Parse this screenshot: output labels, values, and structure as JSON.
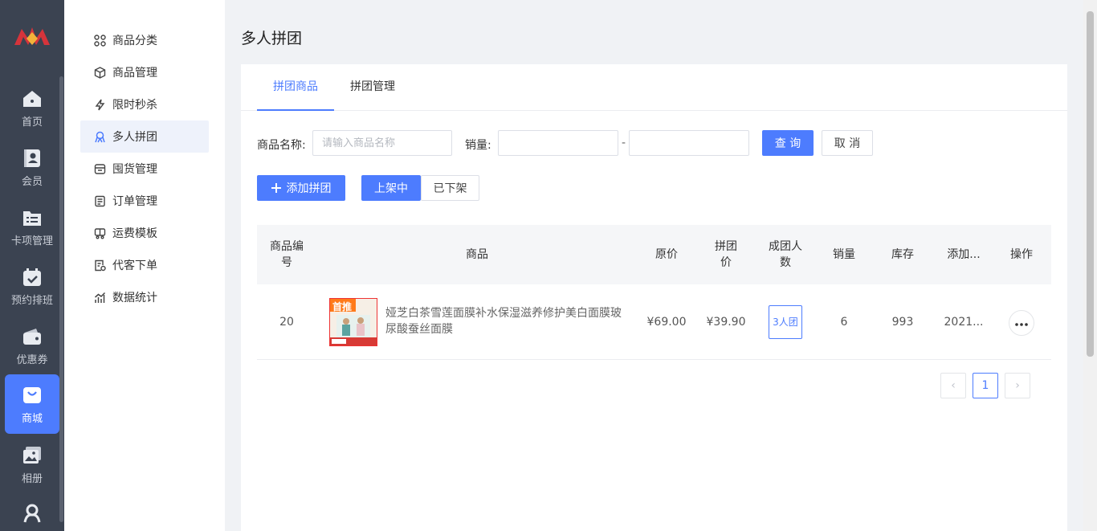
{
  "rail": {
    "items": [
      {
        "label": "首页",
        "icon": "home-icon"
      },
      {
        "label": "会员",
        "icon": "member-icon"
      },
      {
        "label": "卡项管理",
        "icon": "card-folder-icon"
      },
      {
        "label": "预约排班",
        "icon": "calendar-icon"
      },
      {
        "label": "优惠券",
        "icon": "wallet-icon"
      },
      {
        "label": "商城",
        "icon": "shopping-bag-icon"
      },
      {
        "label": "相册",
        "icon": "album-icon"
      }
    ],
    "active_color": "#4d7cfe",
    "background": "#3b4351"
  },
  "subnav": {
    "items": [
      {
        "label": "商品分类",
        "icon": "grid-icon"
      },
      {
        "label": "商品管理",
        "icon": "box-icon"
      },
      {
        "label": "限时秒杀",
        "icon": "lightning-icon"
      },
      {
        "label": "多人拼团",
        "icon": "group-icon"
      },
      {
        "label": "囤货管理",
        "icon": "store-icon"
      },
      {
        "label": "订单管理",
        "icon": "order-list-icon"
      },
      {
        "label": "运费模板",
        "icon": "truck-icon"
      },
      {
        "label": "代客下单",
        "icon": "proxy-order-icon"
      },
      {
        "label": "数据统计",
        "icon": "chart-icon"
      }
    ],
    "active_index": 3
  },
  "page": {
    "title": "多人拼团"
  },
  "tabs": [
    {
      "label": "拼团商品",
      "active": true
    },
    {
      "label": "拼团管理",
      "active": false
    }
  ],
  "filters": {
    "name_label": "商品名称:",
    "name_placeholder": "请输入商品名称",
    "sales_label": "销量:",
    "range_sep": "-",
    "query_label": "查 询",
    "cancel_label": "取 消"
  },
  "actions": {
    "add_label": "添加拼团",
    "status_on": "上架中",
    "status_off": "已下架"
  },
  "table": {
    "headers": {
      "id": "商品编号",
      "product": "商品",
      "orig_price": "原价",
      "group_price": "拼团价",
      "group_size": "成团人数",
      "sales": "销量",
      "stock": "库存",
      "added": "添加...",
      "ops": "操作"
    },
    "rows": [
      {
        "id": "20",
        "badge": "首推",
        "name": "娅芝白茶雪莲面膜补水保湿滋养修护美白面膜玻尿酸蚕丝面膜",
        "orig_price": "¥69.00",
        "group_price": "¥39.90",
        "group_size": "3人团",
        "sales": "6",
        "stock": "993",
        "added": "2021..."
      }
    ]
  },
  "pager": {
    "current": "1",
    "prev": "‹",
    "next": "›"
  },
  "colors": {
    "primary": "#4d7cfe",
    "border": "#dcdfe6"
  }
}
